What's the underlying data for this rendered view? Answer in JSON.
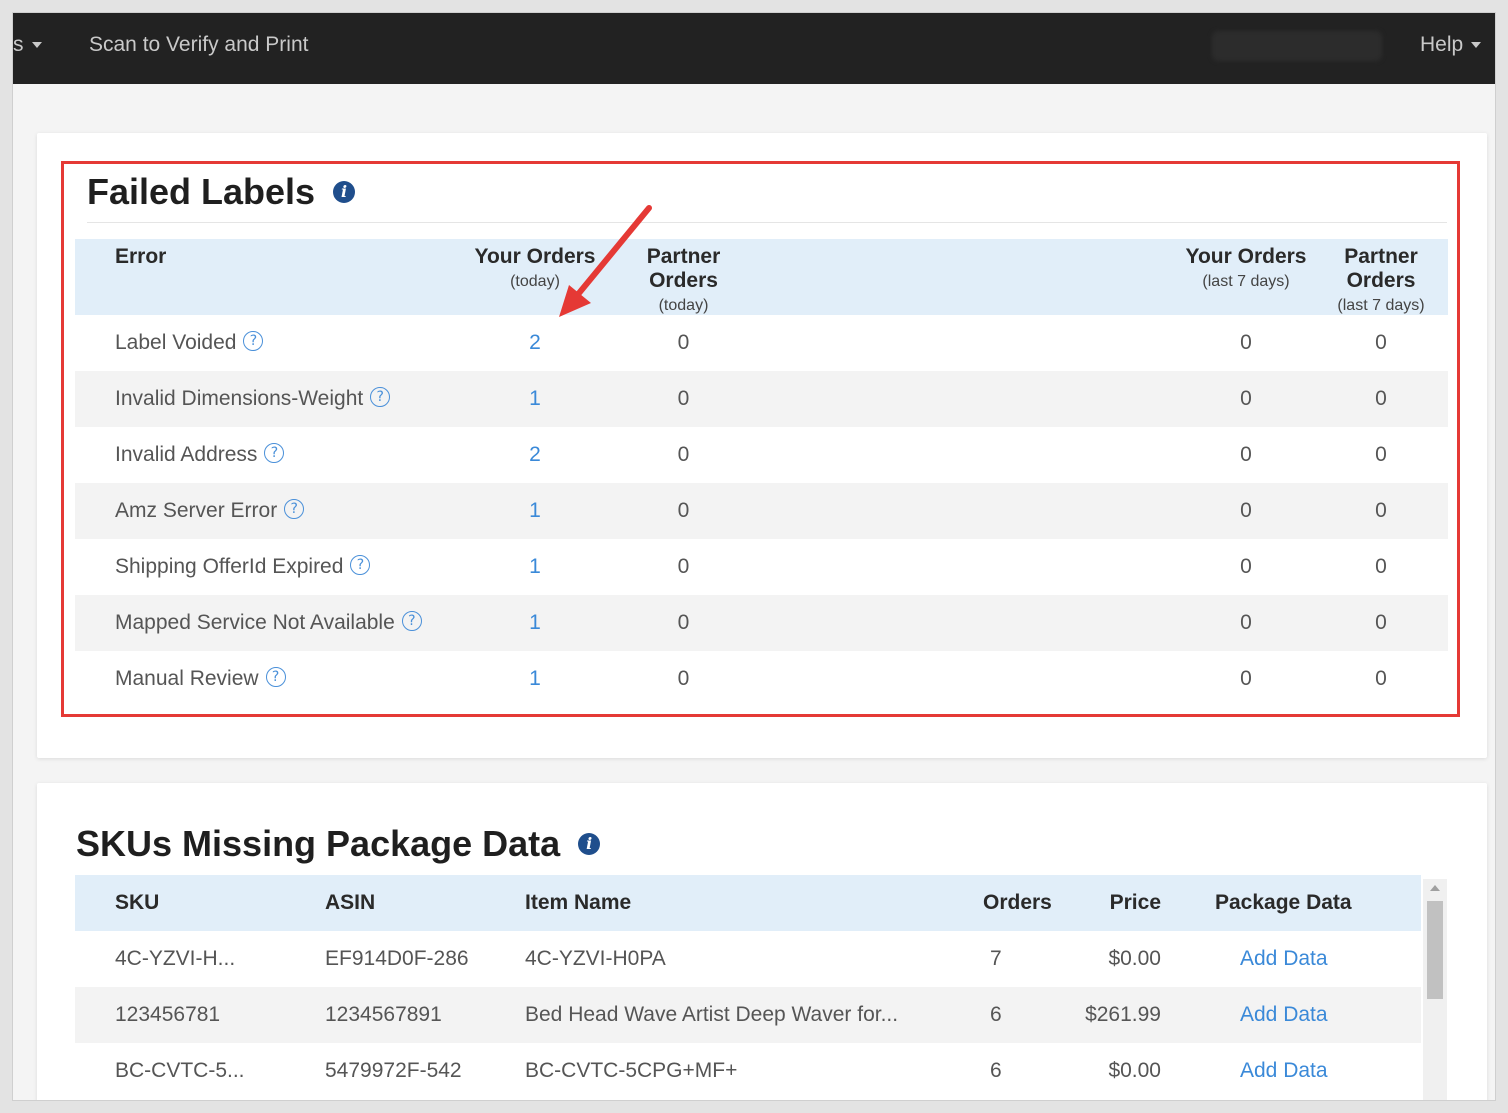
{
  "nav": {
    "left_item": "s",
    "scan_item": "Scan to Verify and Print",
    "help_item": "Help"
  },
  "failed_labels": {
    "title": "Failed Labels",
    "headers": {
      "error": "Error",
      "your_today": "Your Orders",
      "your_today_sub": "(today)",
      "partner_today": "Partner Orders",
      "partner_today_sub": "(today)",
      "your_7": "Your Orders",
      "your_7_sub": "(last 7 days)",
      "partner_7": "Partner Orders",
      "partner_7_sub": "(last 7 days)"
    },
    "rows": [
      {
        "error": "Label Voided",
        "your_today": "2",
        "partner_today": "0",
        "your_7": "0",
        "partner_7": "0"
      },
      {
        "error": "Invalid Dimensions-Weight",
        "your_today": "1",
        "partner_today": "0",
        "your_7": "0",
        "partner_7": "0"
      },
      {
        "error": "Invalid Address",
        "your_today": "2",
        "partner_today": "0",
        "your_7": "0",
        "partner_7": "0"
      },
      {
        "error": "Amz Server Error",
        "your_today": "1",
        "partner_today": "0",
        "your_7": "0",
        "partner_7": "0"
      },
      {
        "error": "Shipping OfferId Expired",
        "your_today": "1",
        "partner_today": "0",
        "your_7": "0",
        "partner_7": "0"
      },
      {
        "error": "Mapped Service Not Available",
        "your_today": "1",
        "partner_today": "0",
        "your_7": "0",
        "partner_7": "0"
      },
      {
        "error": "Manual Review",
        "your_today": "1",
        "partner_today": "0",
        "your_7": "0",
        "partner_7": "0"
      }
    ]
  },
  "skus": {
    "title": "SKUs Missing Package Data",
    "headers": {
      "sku": "SKU",
      "asin": "ASIN",
      "item_name": "Item Name",
      "orders": "Orders",
      "price": "Price",
      "package_data": "Package Data"
    },
    "rows": [
      {
        "sku": "4C-YZVI-H...",
        "asin": "EF914D0F-286",
        "item_name": "4C-YZVI-H0PA",
        "orders": "7",
        "price": "$0.00",
        "action": "Add Data"
      },
      {
        "sku": "123456781",
        "asin": "1234567891",
        "item_name": "Bed Head Wave Artist Deep Waver for...",
        "orders": "6",
        "price": "$261.99",
        "action": "Add Data"
      },
      {
        "sku": "BC-CVTC-5...",
        "asin": "5479972F-542",
        "item_name": "BC-CVTC-5CPG+MF+",
        "orders": "6",
        "price": "$0.00",
        "action": "Add Data"
      }
    ]
  },
  "colors": {
    "highlight_box": "#e53935",
    "annotation_arrow": "#e53935",
    "link": "#3a89d8",
    "header_bg": "#e1eef9",
    "navbar_bg": "#222222"
  }
}
